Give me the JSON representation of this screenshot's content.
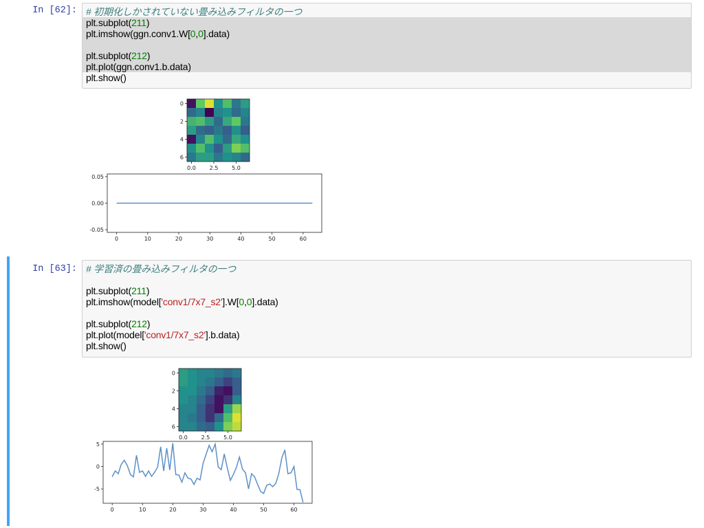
{
  "cells": [
    {
      "prompt": "In [62]:",
      "code": [
        {
          "highlight": false,
          "tokens": [
            {
              "t": "# 初期化しかされていない畳み込みフィルタの一つ",
              "c": "comment"
            }
          ]
        },
        {
          "highlight": true,
          "tokens": [
            {
              "t": "plt.subplot(",
              "c": ""
            },
            {
              "t": "211",
              "c": "num"
            },
            {
              "t": ")",
              "c": ""
            }
          ]
        },
        {
          "highlight": true,
          "tokens": [
            {
              "t": "plt.imshow(ggn.conv1.W[",
              "c": ""
            },
            {
              "t": "0",
              "c": "num"
            },
            {
              "t": ",",
              "c": ""
            },
            {
              "t": "0",
              "c": "num"
            },
            {
              "t": "].data)",
              "c": ""
            }
          ]
        },
        {
          "highlight": true,
          "tokens": [
            {
              "t": "",
              "c": ""
            }
          ]
        },
        {
          "highlight": true,
          "tokens": [
            {
              "t": "plt.subplot(",
              "c": ""
            },
            {
              "t": "212",
              "c": "num"
            },
            {
              "t": ")",
              "c": ""
            }
          ]
        },
        {
          "highlight": true,
          "tokens": [
            {
              "t": "plt.plot(ggn.conv1.b.data)",
              "c": ""
            }
          ]
        },
        {
          "highlight": false,
          "tokens": [
            {
              "t": "plt.show()",
              "c": ""
            }
          ]
        }
      ]
    },
    {
      "prompt": "In [63]:",
      "code": [
        {
          "highlight": false,
          "tokens": [
            {
              "t": "# 学習済の畳み込みフィルタの一つ",
              "c": "comment"
            }
          ]
        },
        {
          "highlight": false,
          "tokens": [
            {
              "t": "",
              "c": ""
            }
          ]
        },
        {
          "highlight": false,
          "tokens": [
            {
              "t": "plt.subplot(",
              "c": ""
            },
            {
              "t": "211",
              "c": "num"
            },
            {
              "t": ")",
              "c": ""
            }
          ]
        },
        {
          "highlight": false,
          "tokens": [
            {
              "t": "plt.imshow(model[",
              "c": ""
            },
            {
              "t": "'conv1/7x7_s2'",
              "c": "str"
            },
            {
              "t": "].W[",
              "c": ""
            },
            {
              "t": "0",
              "c": "num"
            },
            {
              "t": ",",
              "c": ""
            },
            {
              "t": "0",
              "c": "num"
            },
            {
              "t": "].data)",
              "c": ""
            }
          ]
        },
        {
          "highlight": false,
          "tokens": [
            {
              "t": "",
              "c": ""
            }
          ]
        },
        {
          "highlight": false,
          "tokens": [
            {
              "t": "plt.subplot(",
              "c": ""
            },
            {
              "t": "212",
              "c": "num"
            },
            {
              "t": ")",
              "c": ""
            }
          ]
        },
        {
          "highlight": false,
          "tokens": [
            {
              "t": "plt.plot(model[",
              "c": ""
            },
            {
              "t": "'conv1/7x7_s2'",
              "c": "str"
            },
            {
              "t": "].b.data)",
              "c": ""
            }
          ]
        },
        {
          "highlight": false,
          "tokens": [
            {
              "t": "plt.show()",
              "c": ""
            }
          ]
        }
      ]
    }
  ],
  "colors": {
    "line": "#5b8fc7",
    "prompt": "#303f9f",
    "selected_border": "#42a5f5"
  },
  "chart_data": [
    {
      "type": "heatmap",
      "cell": 62,
      "colormap": "viridis",
      "x_ticks": [
        "0.0",
        "2.5",
        "5.0"
      ],
      "y_ticks": [
        "0",
        "2",
        "4",
        "6"
      ],
      "values": [
        [
          0.05,
          0.75,
          0.95,
          0.5,
          0.7,
          0.4,
          0.55
        ],
        [
          0.35,
          0.45,
          0.0,
          0.45,
          0.5,
          0.35,
          0.45
        ],
        [
          0.65,
          0.7,
          0.55,
          0.35,
          0.6,
          0.75,
          0.4
        ],
        [
          0.55,
          0.35,
          0.3,
          0.4,
          0.3,
          0.5,
          0.3
        ],
        [
          0.05,
          0.45,
          0.7,
          0.5,
          0.35,
          0.6,
          0.5
        ],
        [
          0.5,
          0.7,
          0.5,
          0.3,
          0.55,
          0.8,
          0.7
        ],
        [
          0.4,
          0.55,
          0.55,
          0.4,
          0.5,
          0.45,
          0.35
        ]
      ]
    },
    {
      "type": "line",
      "cell": 62,
      "x_ticks": [
        "0",
        "10",
        "20",
        "30",
        "40",
        "50",
        "60"
      ],
      "y_ticks": [
        "0.05",
        "0.00",
        "-0.05"
      ],
      "xlim": [
        -3,
        66
      ],
      "ylim": [
        -0.055,
        0.055
      ],
      "x": [
        0,
        63
      ],
      "y": [
        0,
        0
      ]
    },
    {
      "type": "heatmap",
      "cell": 63,
      "colormap": "viridis",
      "x_ticks": [
        "0.0",
        "2.5",
        "5.0"
      ],
      "y_ticks": [
        "0",
        "2",
        "4",
        "6"
      ],
      "values": [
        [
          0.55,
          0.5,
          0.45,
          0.45,
          0.4,
          0.35,
          0.4
        ],
        [
          0.55,
          0.5,
          0.45,
          0.4,
          0.3,
          0.2,
          0.3
        ],
        [
          0.5,
          0.5,
          0.4,
          0.3,
          0.1,
          0.05,
          0.3
        ],
        [
          0.5,
          0.45,
          0.35,
          0.2,
          0.05,
          0.15,
          0.45
        ],
        [
          0.45,
          0.45,
          0.3,
          0.15,
          0.05,
          0.55,
          0.85
        ],
        [
          0.45,
          0.4,
          0.3,
          0.15,
          0.35,
          0.7,
          0.95
        ],
        [
          0.45,
          0.45,
          0.35,
          0.3,
          0.5,
          0.8,
          0.9
        ]
      ]
    },
    {
      "type": "line",
      "cell": 63,
      "x_ticks": [
        "0",
        "10",
        "20",
        "30",
        "40",
        "50",
        "60"
      ],
      "y_ticks": [
        "5",
        "0",
        "-5"
      ],
      "xlim": [
        -3,
        66
      ],
      "ylim": [
        -8.2,
        5.6
      ],
      "x": [
        0,
        1,
        2,
        3,
        4,
        5,
        6,
        7,
        8,
        9,
        10,
        11,
        12,
        13,
        14,
        15,
        16,
        17,
        18,
        19,
        20,
        21,
        22,
        23,
        24,
        25,
        26,
        27,
        28,
        29,
        30,
        31,
        32,
        33,
        34,
        35,
        36,
        37,
        38,
        39,
        40,
        41,
        42,
        43,
        44,
        45,
        46,
        47,
        48,
        49,
        50,
        51,
        52,
        53,
        54,
        55,
        56,
        57,
        58,
        59,
        60,
        61,
        62,
        63
      ],
      "y": [
        -2.3,
        -1,
        -1.6,
        0.5,
        1.4,
        0.2,
        -1.8,
        -2.3,
        2.5,
        -1.3,
        -1,
        -2.2,
        -1,
        -2.2,
        -1.3,
        -0.1,
        4.4,
        -1,
        4.1,
        -0.8,
        5.2,
        -1.8,
        -1.9,
        -3.5,
        -1.4,
        -2.6,
        -2.8,
        -4,
        -2.6,
        -3,
        0.7,
        2.7,
        4.7,
        3.3,
        5,
        -0.1,
        -0.7,
        2.8,
        -0.3,
        -3.1,
        -1.8,
        -0.2,
        2.1,
        -0.6,
        -1.4,
        -5,
        -1.6,
        -2.3,
        -4,
        -5.6,
        -6,
        -4.2,
        -3.9,
        -4.5,
        -3.8,
        -1.6,
        1.9,
        3.7,
        -1.6,
        -1.4,
        0,
        -5.1,
        -5.2,
        -8
      ]
    }
  ]
}
